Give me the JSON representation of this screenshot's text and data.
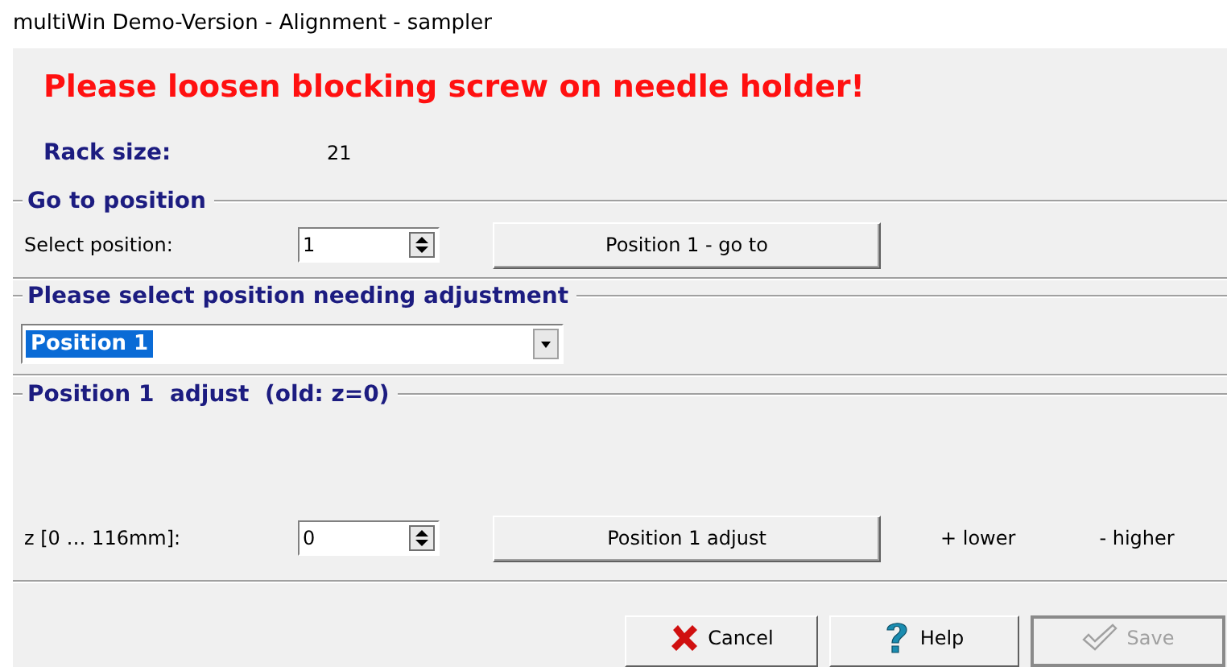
{
  "window": {
    "title": "multiWin Demo-Version - Alignment - sampler"
  },
  "warning": "Please loosen blocking screw on needle holder!",
  "rack_size": {
    "label": "Rack size:",
    "value": "21"
  },
  "go_to_position": {
    "title": "Go to position",
    "label": "Select position:",
    "value": "1",
    "button": "Position 1 - go to"
  },
  "select_position": {
    "title": "Please select position needing adjustment",
    "value": "Position 1",
    "selected": true
  },
  "adjust": {
    "title": "Position 1  adjust  (old: z=0)",
    "label": "z [0 … 116mm]:",
    "value": "0",
    "button": "Position 1 adjust",
    "hints": [
      "+ lower",
      "- higher"
    ]
  },
  "buttons": [
    {
      "label": "Cancel",
      "kind": "cancel",
      "disabled": false
    },
    {
      "label": "Help",
      "kind": "help",
      "disabled": false
    },
    {
      "label": "Save",
      "kind": "save",
      "disabled": true
    }
  ]
}
